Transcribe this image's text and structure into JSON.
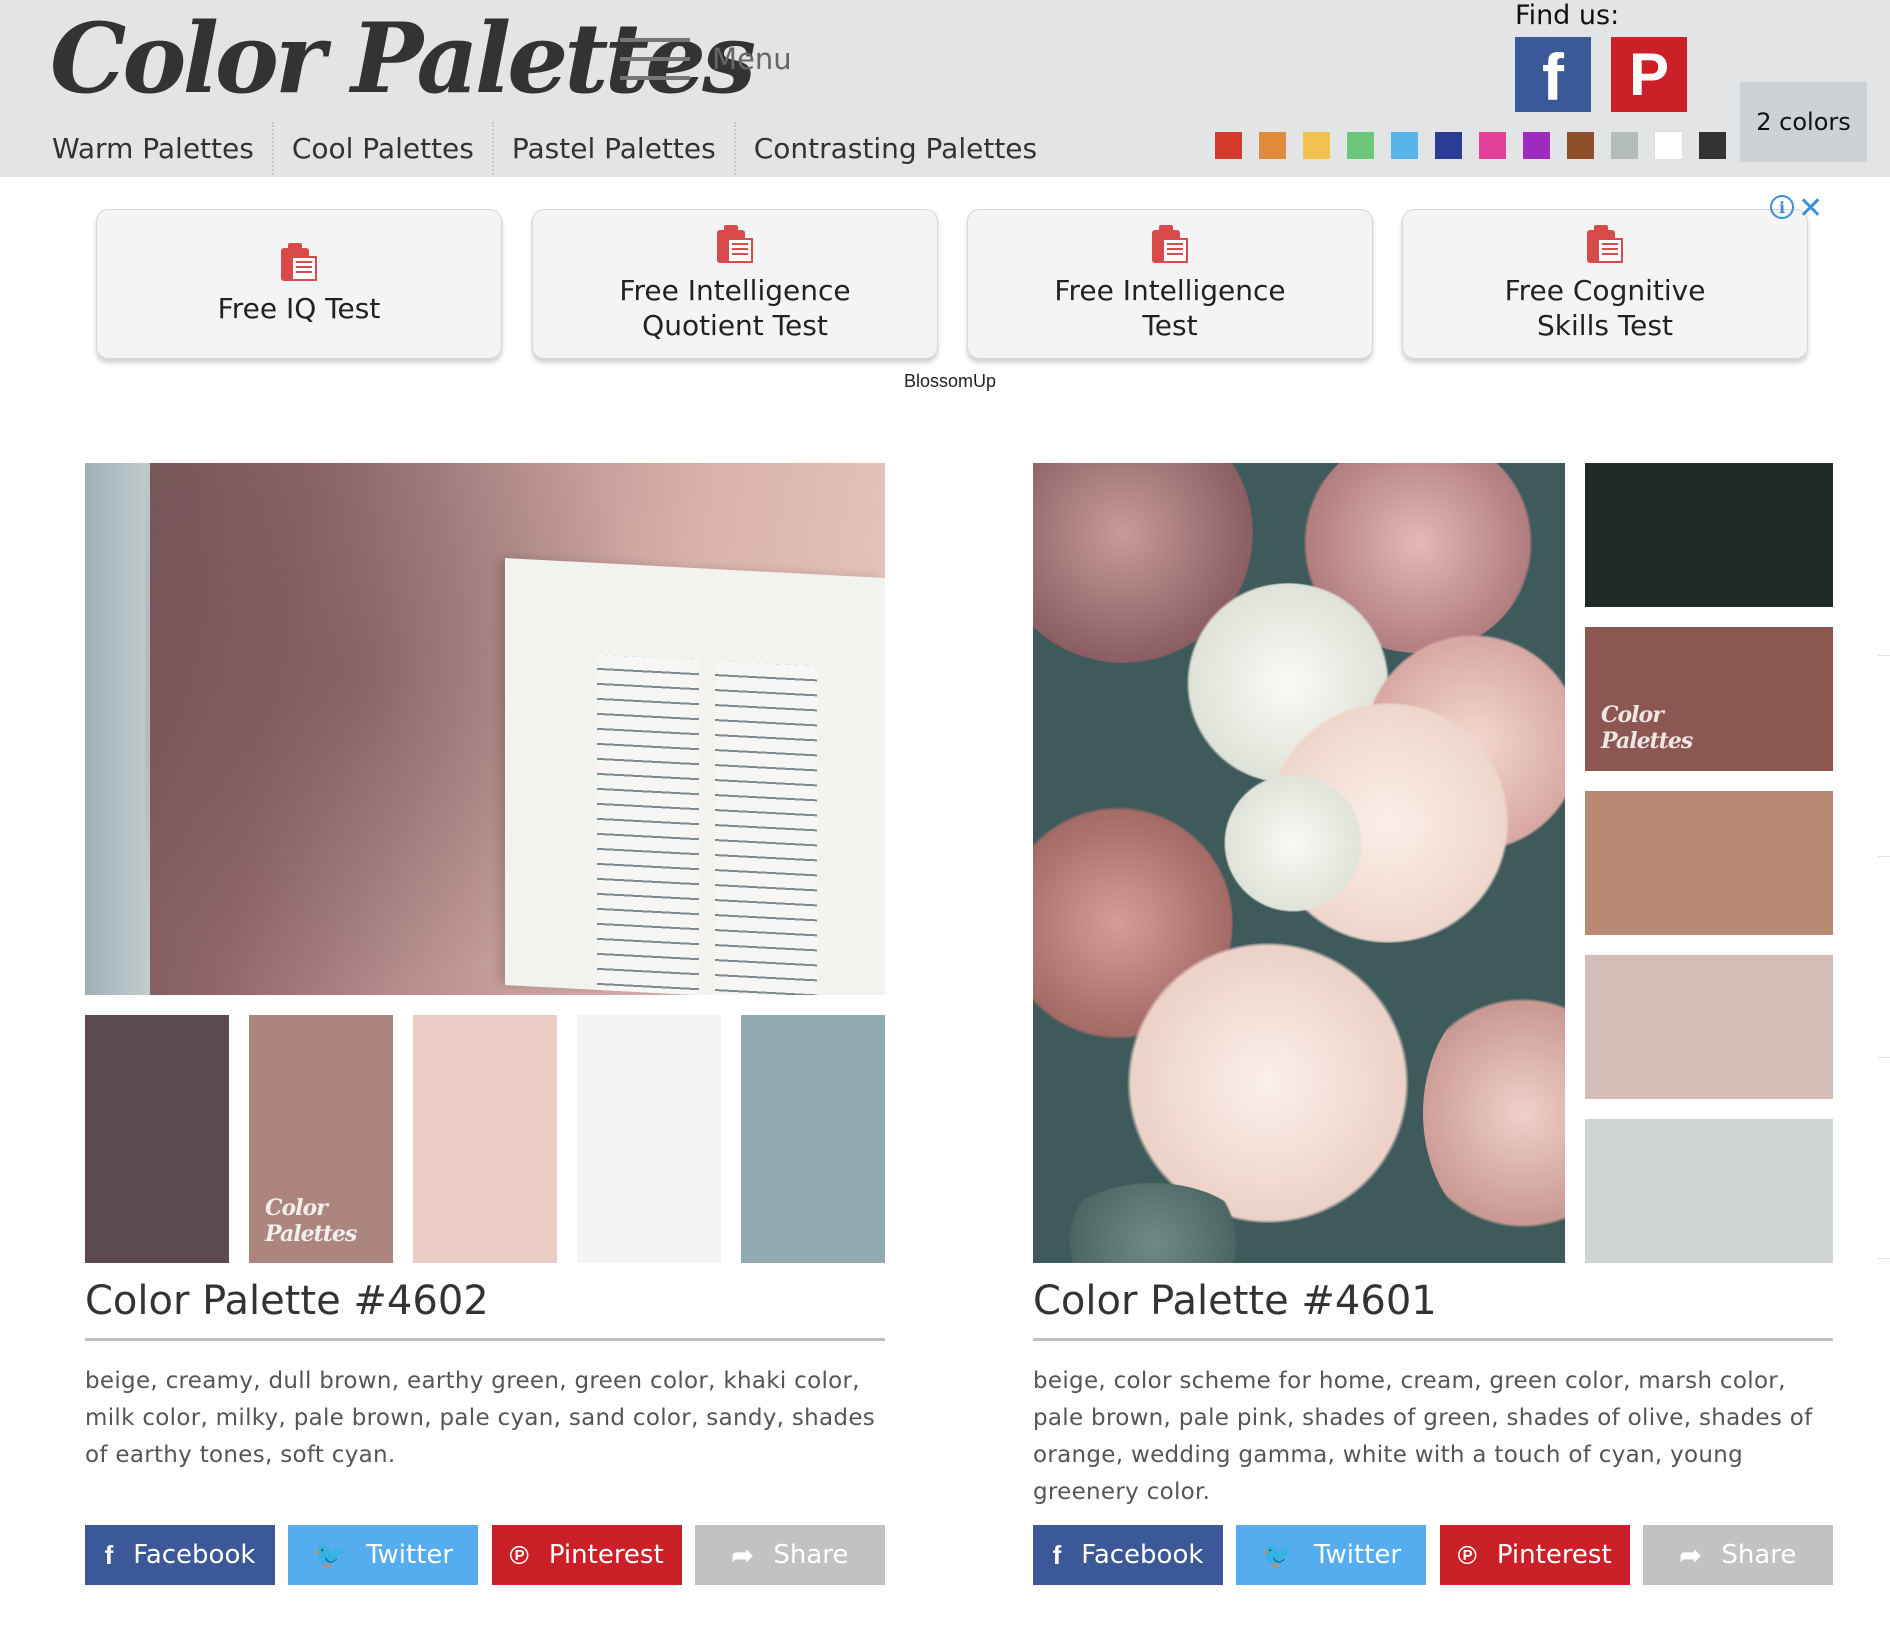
{
  "header": {
    "logo": "Color Palettes",
    "menu_label": "Menu",
    "nav": [
      "Warm Palettes",
      "Cool Palettes",
      "Pastel Palettes",
      "Contrasting Palettes"
    ],
    "find_us": "Find us:",
    "facebook_glyph": "f",
    "pinterest_glyph": "P",
    "color_filters": [
      "#d33a2c",
      "#e08a3c",
      "#f2c14e",
      "#6cc77a",
      "#5ab4ec",
      "#2b3c94",
      "#e3409a",
      "#9c2bbf",
      "#8f4f2a",
      "#b3bcbb",
      "#ffffff",
      "#333333"
    ],
    "colors_button": "2 colors"
  },
  "ad": {
    "cards": [
      "Free IQ Test",
      "Free Intelligence Quotient Test",
      "Free Intelligence Test",
      "Free Cognitive Skills Test"
    ],
    "brand": "BlossomUp",
    "info_glyph": "i",
    "close_glyph": "✕"
  },
  "palettes": [
    {
      "title": "Color Palette #4602",
      "tags": "beige, creamy, dull brown, earthy green, green color, khaki color, milk color, milky, pale brown, pale cyan, sand color, sandy, shades of earthy tones, soft cyan.",
      "colors": [
        "#5d4a4e",
        "#ab857e",
        "#e9cdc5",
        "#f4f4f3",
        "#93aab1"
      ],
      "watermark": "Color Palettes"
    },
    {
      "title": "Color Palette #4601",
      "tags": "beige, color scheme for home, cream, green color, marsh color, pale brown, pale pink, shades of green, shades of olive, shades of orange, wedding gamma, white with a touch of cyan, young greenery color.",
      "colors": [
        "#1f2b27",
        "#8b5750",
        "#b88a74",
        "#d4bdb6",
        "#ced5d4"
      ],
      "watermark": "Color Palettes"
    }
  ],
  "share": {
    "facebook": "Facebook",
    "twitter": "Twitter",
    "pinterest": "Pinterest",
    "share": "Share",
    "facebook_glyph": "f",
    "twitter_glyph": "🐦",
    "pinterest_glyph": "℗",
    "share_glyph": "➦"
  },
  "icons": {
    "logo": "wordmark",
    "menu": "hamburger-icon",
    "ad_item": "clipboard-icon",
    "ad_info": "info-icon",
    "ad_close": "close-icon"
  }
}
